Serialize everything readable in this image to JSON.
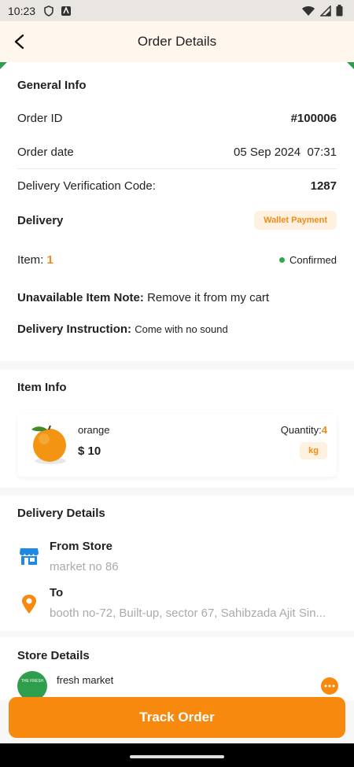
{
  "status_bar": {
    "time": "10:23"
  },
  "app_bar": {
    "title": "Order Details"
  },
  "general_info": {
    "title": "General Info",
    "order_id_label": "Order ID",
    "order_id": "#100006",
    "order_date_label": "Order date",
    "order_date": "05 Sep 2024  07:31",
    "verification_label": "Delivery Verification Code:",
    "verification_code": "1287",
    "delivery_label": "Delivery",
    "payment_badge": "Wallet Payment",
    "item_label": "Item:",
    "item_count": "1",
    "status": "Confirmed",
    "unavailable_label": "Unavailable Item Note:",
    "unavailable_value": "Remove it from my cart",
    "instruction_label": "Delivery Instruction:",
    "instruction_value": "Come with no sound"
  },
  "item_info": {
    "title": "Item Info",
    "items": [
      {
        "name": "orange",
        "price": "$ 10",
        "quantity_label": "Quantity:",
        "quantity": "4",
        "unit": "kg"
      }
    ]
  },
  "delivery_details": {
    "title": "Delivery Details",
    "from_label": "From Store",
    "from_value": "market no 86",
    "to_label": "To",
    "to_value": "booth no-72, Built-up, sector 67, Sahibzada Ajit Sin..."
  },
  "store_details": {
    "title": "Store Details",
    "store_name": "fresh market",
    "logo_text": "THE FRESH"
  },
  "actions": {
    "track_order": "Track Order"
  },
  "colors": {
    "accent": "#f7890f",
    "status_green": "#2faa4a",
    "header_bg": "#fff6ee"
  }
}
